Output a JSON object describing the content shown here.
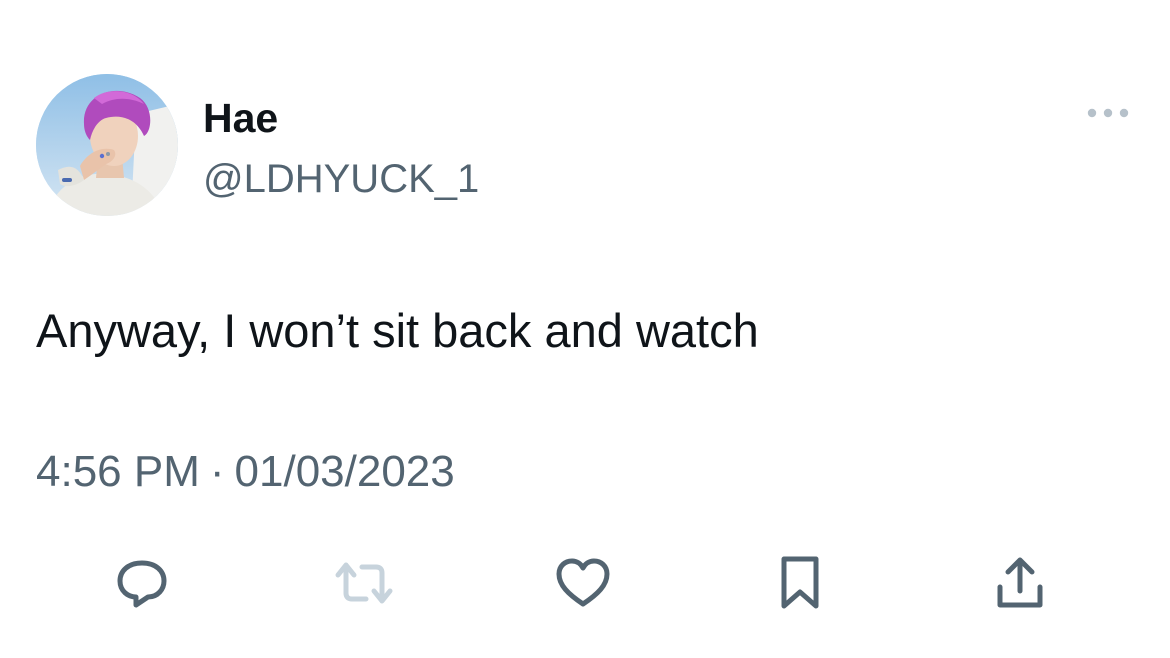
{
  "tweet": {
    "author": {
      "display_name": "Hae",
      "handle": "@LDHYUCK_1"
    },
    "text": "Anyway, I won’t sit back and watch",
    "time": "4:56 PM",
    "separator": "·",
    "date": "01/03/2023"
  },
  "icons": {
    "more": "more-horizontal-icon",
    "reply": "reply-bubble-icon",
    "retweet": "retweet-icon",
    "like": "heart-icon",
    "bookmark": "bookmark-icon",
    "share": "share-upload-icon"
  },
  "colors": {
    "text_primary": "#0f1419",
    "text_secondary": "#536471",
    "icon": "#536471",
    "icon_disabled": "#c7d3dc",
    "background": "#ffffff"
  }
}
